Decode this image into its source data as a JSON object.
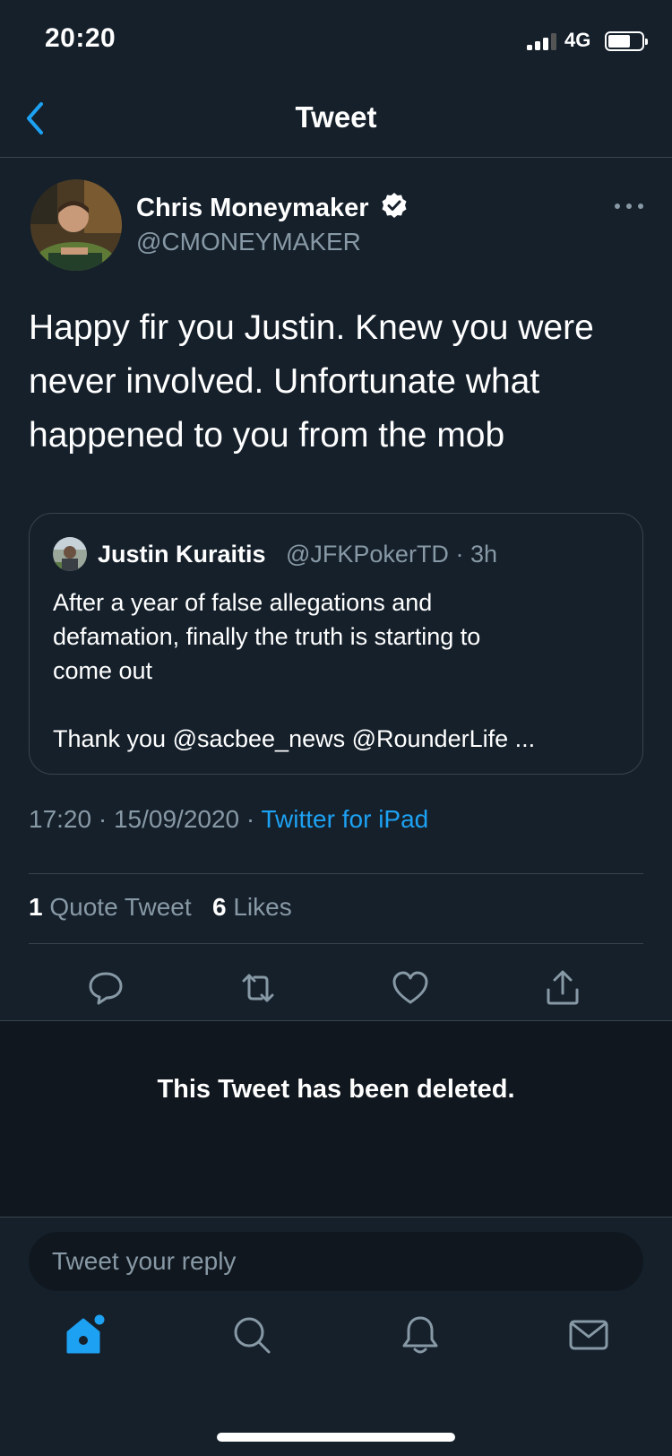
{
  "status_bar": {
    "time": "20:20",
    "network": "4G"
  },
  "nav": {
    "title": "Tweet"
  },
  "tweet": {
    "author_name": "Chris Moneymaker",
    "author_handle": "@CMONEYMAKER",
    "lines": [
      "Happy fir you Justin. Knew you were",
      "never involved. Unfortunate what",
      "happened to you from the mob"
    ],
    "time": "17:20",
    "date": "15/09/2020",
    "source": "Twitter for iPad",
    "quote_tweet_count": "1",
    "quote_tweet_label": "Quote Tweet",
    "likes_count": "6",
    "likes_label": "Likes"
  },
  "quoted_tweet": {
    "author_name": "Justin Kuraitis",
    "author_handle": "@JFKPokerTD",
    "age": "3h",
    "lines": [
      "After a year of false allegations and",
      "defamation, finally the truth is starting to",
      "come out",
      "",
      "Thank you @sacbee_news @RounderLife ..."
    ]
  },
  "deleted_notice": "This Tweet has been deleted.",
  "reply": {
    "placeholder": "Tweet your reply"
  },
  "colors": {
    "background": "#15202b",
    "accent": "#1da1f2",
    "muted": "#8899a6",
    "divider": "#38444d"
  }
}
